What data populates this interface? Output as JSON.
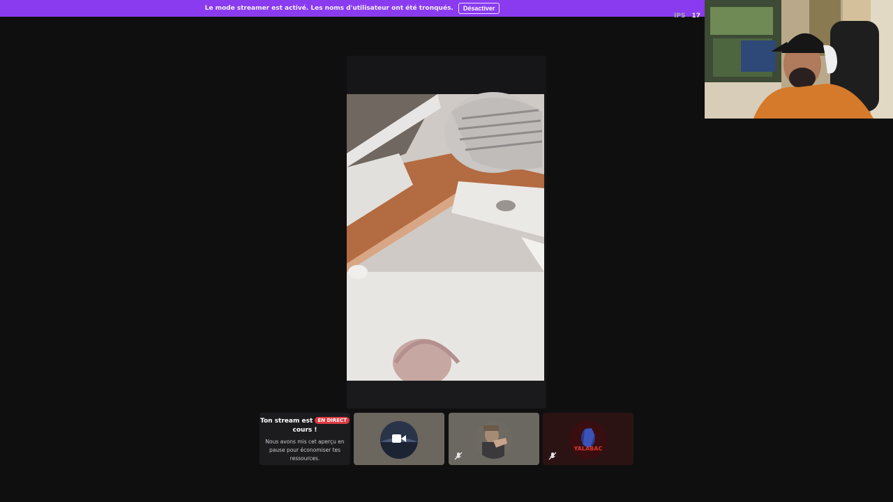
{
  "banner": {
    "text": "Le mode streamer est activé. Les noms d'utilisateur ont été tronqués.",
    "button_label": "Désactiver"
  },
  "fps": {
    "label": "IPS",
    "value": "17"
  },
  "stream_notice": {
    "title_part1": "Ton stream est",
    "badge": "EN DIRECT",
    "title_part2": "cours !",
    "description": "Nous avons mis cet aperçu en pause pour économiser tes ressources."
  },
  "participants": [
    {
      "id": "camera-user",
      "icon": "video-camera-icon",
      "muted": false
    },
    {
      "id": "gesture-user",
      "icon": "muted-mic-icon",
      "muted": true
    },
    {
      "id": "yalabac",
      "avatar_text": "YALABAC",
      "icon": "muted-mic-icon",
      "muted": true
    }
  ],
  "colors": {
    "banner": "#8a3bf0",
    "live_badge": "#dd3c44",
    "background": "#0f0f10"
  }
}
